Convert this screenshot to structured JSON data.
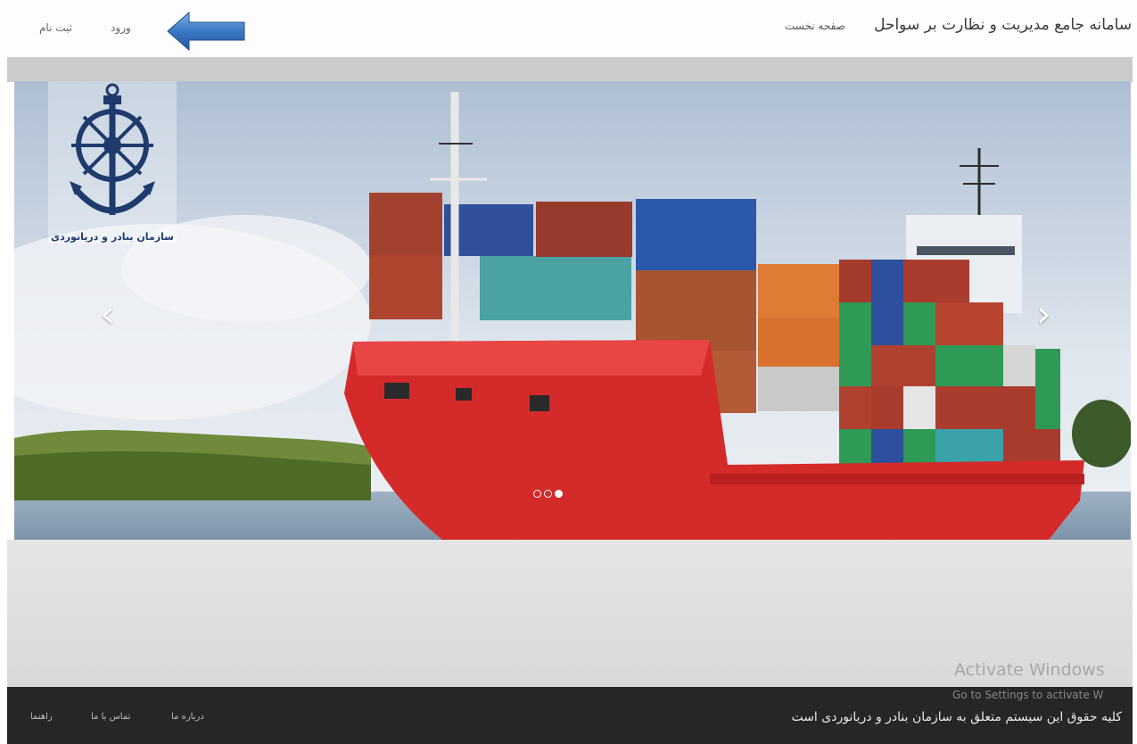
{
  "navbar": {
    "brand": "سامانه جامع مدیریت و نظارت بر سواحل",
    "home": "صفحه نخست",
    "login": "ورود",
    "register": "ثبت نام",
    "arrow_color": "#3a78c2"
  },
  "carousel": {
    "logo_caption": "سازمان بنادر و دریانوردی",
    "prev_icon": "‹",
    "next_icon": "›",
    "slide_count": 3,
    "active_slide": 3
  },
  "watermark": {
    "title": "Activate Windows",
    "subtitle": "Go to Settings to activate W"
  },
  "footer": {
    "copyright": "کلیه حقوق این سیستم متعلق به سازمان بنادر و دریانوردی است",
    "links": {
      "about": "درباره ما",
      "contact": "تماس با ما",
      "guide": "راهنما"
    }
  },
  "colors": {
    "footer_bg": "#262626",
    "ship_hull": "#d42a2a",
    "logo_blue": "#1f3b6e"
  }
}
